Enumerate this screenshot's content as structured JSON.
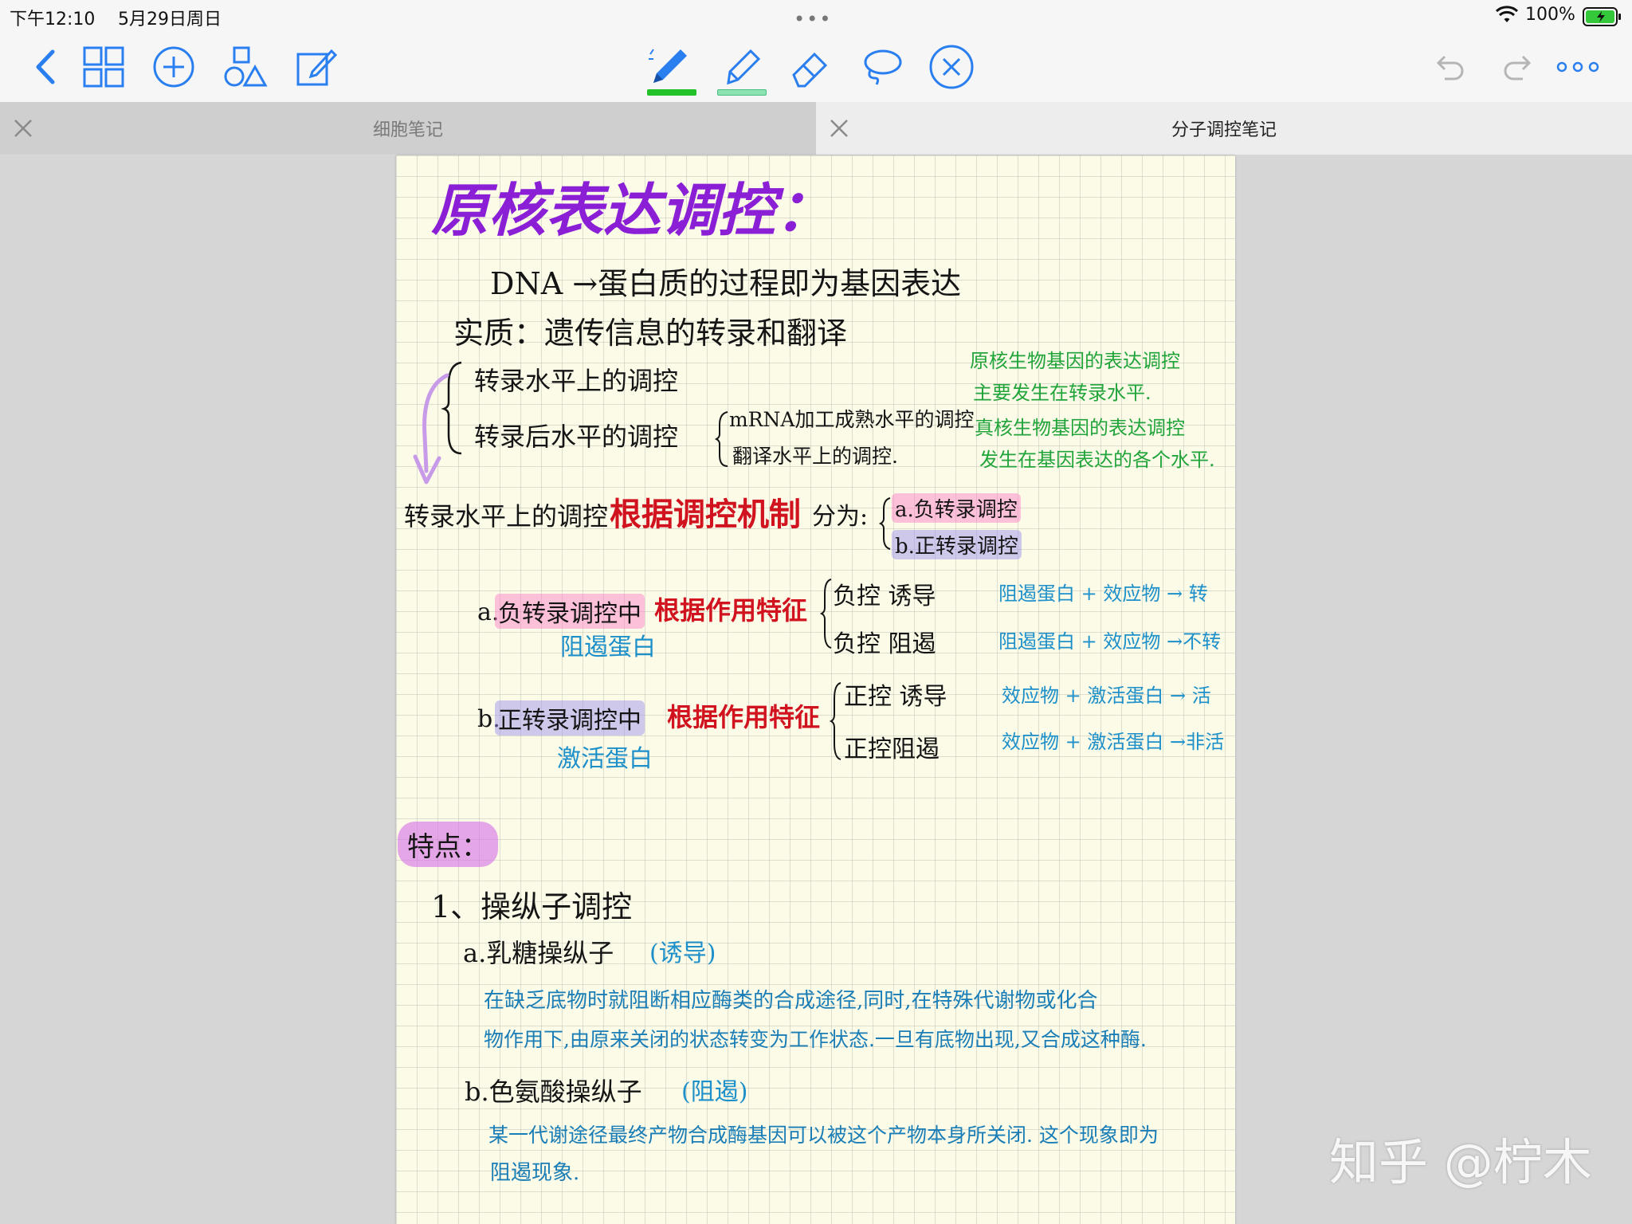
{
  "status_bar": {
    "time": "下午12:10",
    "date": "5月29日周日",
    "battery": "100%"
  },
  "toolbar": {
    "pen_color": "#22c228",
    "highlighter_color": "#8be3b1",
    "accent": "#2a7ff0",
    "icons": [
      "chevron-left-icon",
      "grid-icon",
      "plus-circle-icon",
      "shapes-icon",
      "edit-icon",
      "pen-icon",
      "highlighter-icon",
      "eraser-icon",
      "lasso-icon",
      "disable-circle-icon",
      "undo-icon",
      "redo-icon",
      "more-icon"
    ]
  },
  "tabs": [
    {
      "label": "细胞笔记",
      "active": false
    },
    {
      "label": "分子调控笔记",
      "active": true
    }
  ],
  "note": {
    "title": "原核表达调控：",
    "line1": "DNA →蛋白质的过程即为基因表达",
    "line2": "实质：遗传信息的转录和翻译",
    "b1": "转录水平上的调控",
    "b2": "转录后水平的调控",
    "b2a": "mRNA加工成熟水平的调控",
    "b2b": "翻译水平上的调控.",
    "side1": "原核生物基因的表达调控",
    "side2": "主要发生在转录水平.",
    "side3": "真核生物基因的表达调控",
    "side4": "发生在基因表达的各个水平.",
    "row_a_prefix": "转录水平上的调控",
    "row_a_red": "根据调控机制",
    "row_a_suffix": "分为:",
    "type_a": "a.负转录调控",
    "type_b": "b.正转录调控",
    "neg_prefix": "a.",
    "neg_hl": "负转录调控中",
    "neg_red": "根据作用特征",
    "neg_sub": "阻遏蛋白",
    "neg_1": "负控 诱导",
    "neg_2": "负控 阻遏",
    "neg_r1": "阻遏蛋白 + 效应物 → 转",
    "neg_r2": "阻遏蛋白 + 效应物 →不转",
    "pos_prefix": "b.",
    "pos_hl": "正转录调控中",
    "pos_red": "根据作用特征",
    "pos_sub": "激活蛋白",
    "pos_1": "正控 诱导",
    "pos_2": "正控阻遏",
    "pos_r1": "效应物 + 激活蛋白 → 活",
    "pos_r2": "效应物 + 激活蛋白 →非活",
    "feature": "特点：",
    "h1": "1、操纵子调控",
    "h1a": "a.乳糖操纵子",
    "h1a_tag": "(诱导)",
    "p1": "在缺乏底物时就阻断相应酶类的合成途径,同时,在特殊代谢物或化合",
    "p2": "物作用下,由原来关闭的状态转变为工作状态.一旦有底物出现,又合成这种酶.",
    "h1b": "b.色氨酸操纵子",
    "h1b_tag": "(阻遏)",
    "p3": "某一代谢途径最终产物合成酶基因可以被这个产物本身所关闭. 这个现象即为",
    "p4": "阻遏现象."
  },
  "watermark": "知乎 @柠木"
}
